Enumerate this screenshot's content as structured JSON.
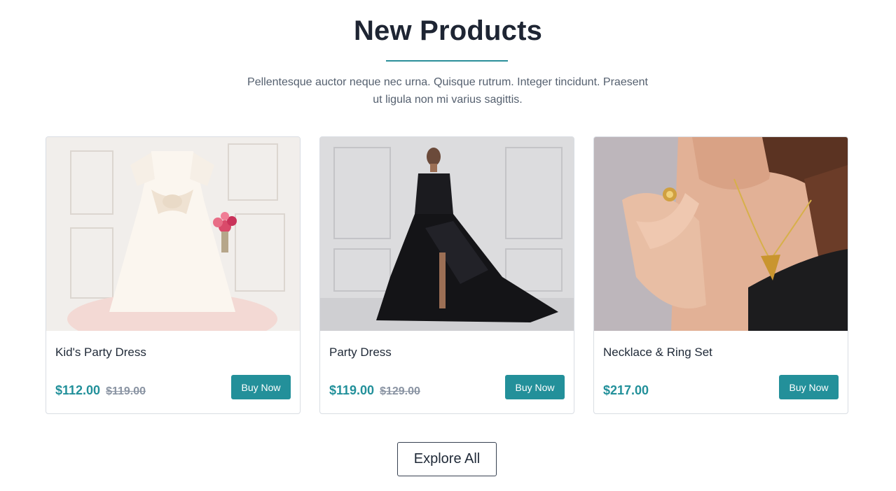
{
  "section": {
    "title": "New Products",
    "subtitle_line1": "Pellentesque auctor neque nec urna. Quisque rutrum. Integer tincidunt. Praesent",
    "subtitle_line2": "ut ligula non mi varius sagittis."
  },
  "products": [
    {
      "name": "Kid's Party Dress",
      "price": "$112.00",
      "old_price": "$119.00",
      "buy_label": "Buy Now",
      "image_icon": "kids-dress-photo"
    },
    {
      "name": "Party Dress",
      "price": "$119.00",
      "old_price": "$129.00",
      "buy_label": "Buy Now",
      "image_icon": "party-dress-photo"
    },
    {
      "name": "Necklace & Ring Set",
      "price": "$217.00",
      "old_price": "",
      "buy_label": "Buy Now",
      "image_icon": "jewelry-photo"
    }
  ],
  "explore": {
    "label": "Explore All"
  },
  "colors": {
    "accent": "#23909a",
    "title": "#1e2533",
    "old_price": "#8a94a3",
    "card_border": "#d9dde3"
  }
}
